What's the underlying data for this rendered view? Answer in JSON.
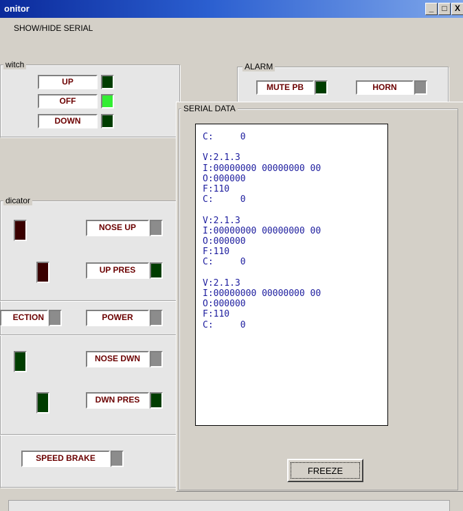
{
  "window": {
    "title": "onitor",
    "caption_buttons": [
      "_",
      "□",
      "X"
    ]
  },
  "menu": {
    "items": [
      "SHOW/HIDE SERIAL"
    ]
  },
  "switch_group": {
    "label": "witch",
    "buttons": [
      {
        "label": "UP",
        "led": "#003d00"
      },
      {
        "label": "OFF",
        "led": "#33ee33"
      },
      {
        "label": "DOWN",
        "led": "#003d00"
      }
    ]
  },
  "alarm_group": {
    "label": "ALARM",
    "items": [
      {
        "label": "MUTE PB",
        "led": "#003d00"
      },
      {
        "label": "HORN",
        "led": "#8c8c8c"
      }
    ]
  },
  "indicator_group": {
    "label": "dicator",
    "rows": [
      {
        "label": "NOSE UP",
        "led": "#8c8c8c",
        "side_led": "#3a0000"
      },
      {
        "label": "UP PRES",
        "led": "#003d00",
        "side_led": "#3a0000"
      },
      {
        "label": "ECTION",
        "led": "#8c8c8c"
      },
      {
        "label": "POWER",
        "led": "#8c8c8c"
      },
      {
        "label": "NOSE DWN",
        "led": "#8c8c8c",
        "side_led": "#003d00"
      },
      {
        "label": "DWN PRES",
        "led": "#003d00",
        "side_led": "#003d00"
      },
      {
        "label": "SPEED BRAKE",
        "led": "#8c8c8c"
      }
    ]
  },
  "serial_panel": {
    "label": "SERIAL DATA",
    "lines": [
      "C:     0",
      "",
      "V:2.1.3",
      "I:00000000 00000000 00",
      "O:000000",
      "F:110",
      "C:     0",
      "",
      "V:2.1.3",
      "I:00000000 00000000 00",
      "O:000000",
      "F:110",
      "C:     0",
      "",
      "V:2.1.3",
      "I:00000000 00000000 00",
      "O:000000",
      "F:110",
      "C:     0"
    ],
    "freeze_label": "FREEZE"
  },
  "colors": {
    "label_text": "#6b0000",
    "led_dark_green": "#003d00",
    "led_bright_green": "#33ee33",
    "led_gray": "#8c8c8c",
    "led_dark_red": "#3a0000",
    "serial_text": "#1c1c9e",
    "titlebar": "#0b2a9b"
  }
}
